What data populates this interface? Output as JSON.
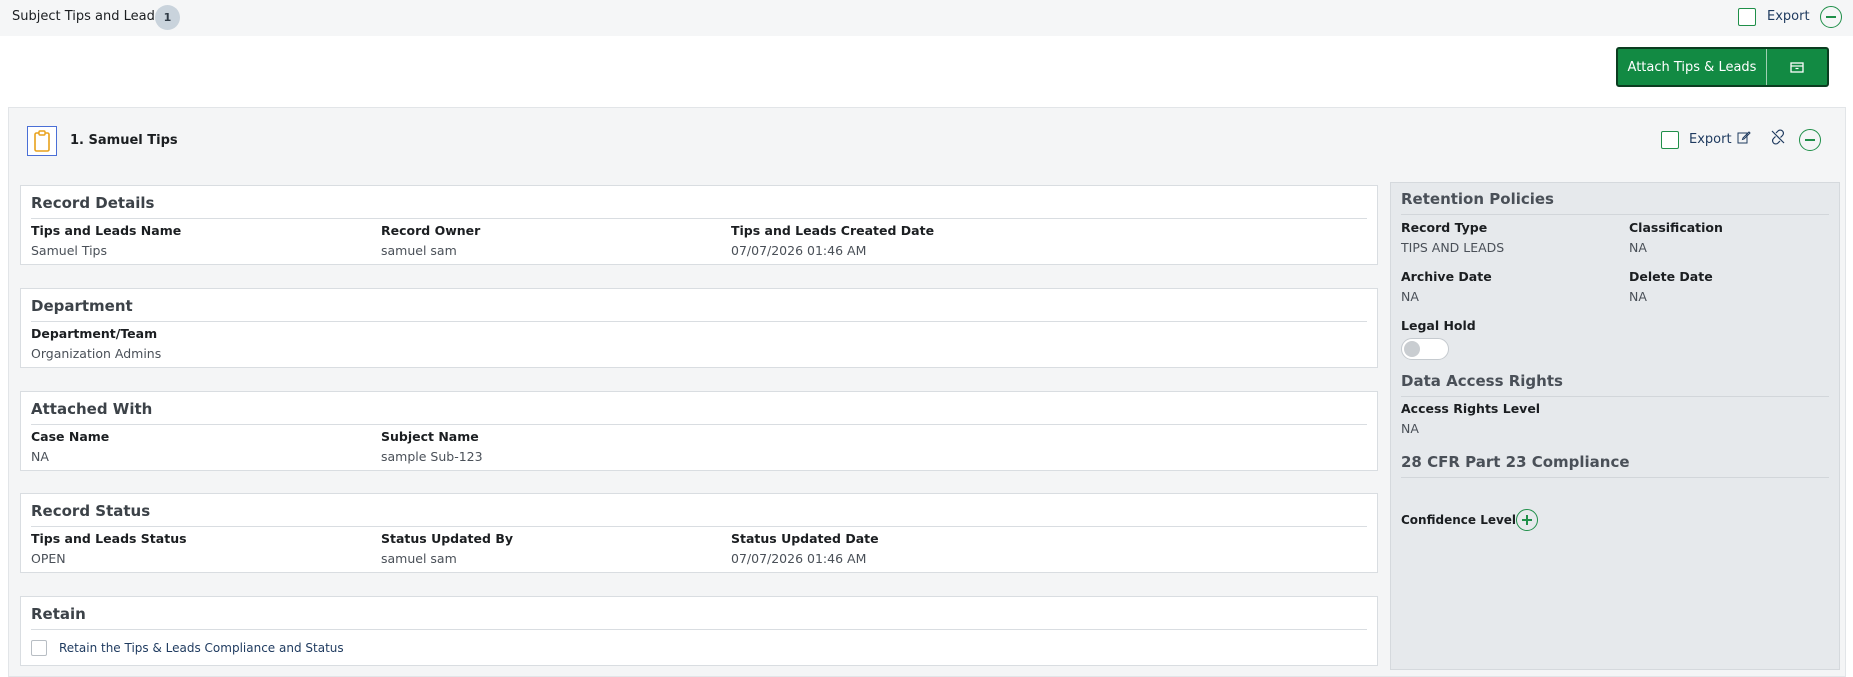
{
  "topbar": {
    "title": "Subject Tips and Leads",
    "count": "1",
    "export_label": "Export"
  },
  "attach_button": {
    "label": "Attach Tips & Leads"
  },
  "panel": {
    "title": "1. Samuel Tips",
    "export_label": "Export"
  },
  "record_details": {
    "heading": "Record Details",
    "fields": [
      {
        "label": "Tips and Leads Name",
        "value": "Samuel Tips"
      },
      {
        "label": "Record Owner",
        "value": "samuel sam"
      },
      {
        "label": "Tips and Leads Created Date",
        "value": "07/07/2026 01:46 AM"
      }
    ]
  },
  "department": {
    "heading": "Department",
    "fields": [
      {
        "label": "Department/Team",
        "value": "Organization Admins"
      }
    ]
  },
  "attached_with": {
    "heading": "Attached With",
    "fields": [
      {
        "label": "Case Name",
        "value": "NA"
      },
      {
        "label": "Subject Name",
        "value": "sample Sub-123"
      }
    ]
  },
  "record_status": {
    "heading": "Record Status",
    "fields": [
      {
        "label": "Tips and Leads Status",
        "value": "OPEN"
      },
      {
        "label": "Status Updated By",
        "value": "samuel sam"
      },
      {
        "label": "Status Updated Date",
        "value": "07/07/2026 01:46 AM"
      }
    ]
  },
  "retain": {
    "heading": "Retain",
    "checkbox_label": "Retain the Tips & Leads Compliance and Status"
  },
  "side": {
    "retention_heading": "Retention Policies",
    "record_type": {
      "label": "Record Type",
      "value": "TIPS AND LEADS"
    },
    "classification": {
      "label": "Classification",
      "value": "NA"
    },
    "archive_date": {
      "label": "Archive Date",
      "value": "NA"
    },
    "delete_date": {
      "label": "Delete Date",
      "value": "NA"
    },
    "legal_hold_label": "Legal Hold",
    "access_heading": "Data Access Rights",
    "access_level": {
      "label": "Access Rights Level",
      "value": "NA"
    },
    "compliance_heading": "28 CFR Part 23 Compliance",
    "confidence_label": "Confidence Level"
  },
  "colors": {
    "accent": "#128a43",
    "panel_bg": "#f4f5f6",
    "side_bg": "#e6e9ec"
  }
}
